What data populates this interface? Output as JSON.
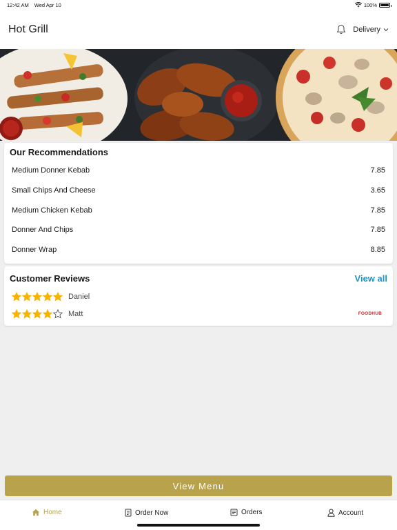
{
  "status_bar": {
    "time": "12:42 AM",
    "date": "Wed Apr 10",
    "battery": "100%",
    "battery_level": 1.0
  },
  "header": {
    "title": "Hot Grill",
    "delivery_label": "Delivery"
  },
  "recommendations": {
    "title": "Our Recommendations",
    "items": [
      {
        "name": "Medium Donner Kebab",
        "price": "7.85"
      },
      {
        "name": "Small Chips And Cheese",
        "price": "3.65"
      },
      {
        "name": "Medium Chicken Kebab",
        "price": "7.85"
      },
      {
        "name": "Donner And Chips",
        "price": "7.85"
      },
      {
        "name": "Donner Wrap",
        "price": "8.85"
      }
    ]
  },
  "reviews": {
    "title": "Customer Reviews",
    "view_all": "View all",
    "items": [
      {
        "name": "Daniel",
        "rating": 5
      },
      {
        "name": "Matt",
        "rating": 4
      }
    ],
    "brand": "FOODHUB"
  },
  "actions": {
    "view_menu": "View Menu"
  },
  "tabs": [
    {
      "label": "Home",
      "icon": "home-icon",
      "active": true
    },
    {
      "label": "Order Now",
      "icon": "order-icon",
      "active": false
    },
    {
      "label": "Orders",
      "icon": "receipt-icon",
      "active": false
    },
    {
      "label": "Account",
      "icon": "user-icon",
      "active": false
    }
  ],
  "colors": {
    "accent": "#b8a34c",
    "link": "#1c95c4",
    "star": "#f6b400",
    "brand_red": "#d11f2a"
  }
}
